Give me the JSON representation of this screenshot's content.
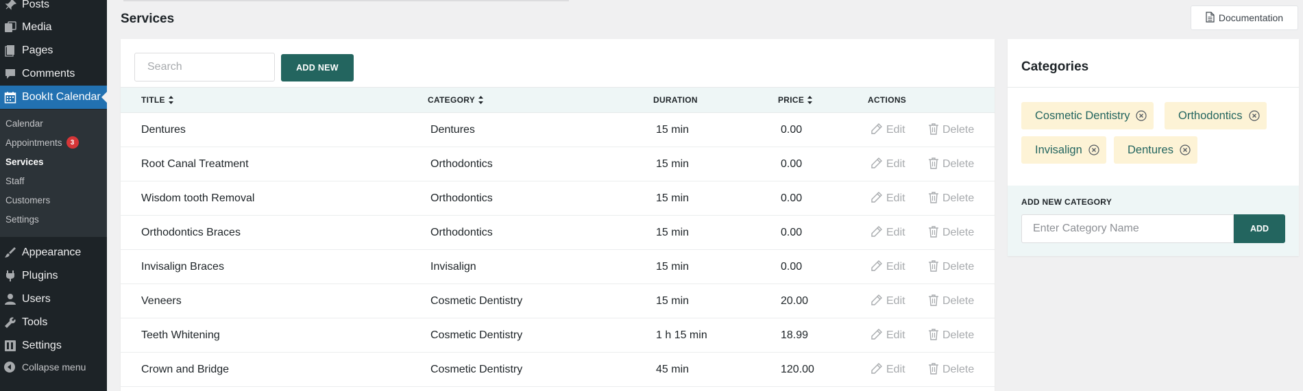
{
  "sidebar": {
    "menu": [
      {
        "label": "Posts",
        "icon": "pin-icon"
      },
      {
        "label": "Media",
        "icon": "media-icon"
      },
      {
        "label": "Pages",
        "icon": "pages-icon"
      },
      {
        "label": "Comments",
        "icon": "comment-icon"
      },
      {
        "label": "BookIt Calendar",
        "icon": "calendar-icon"
      }
    ],
    "submenu": [
      {
        "label": "Calendar"
      },
      {
        "label": "Appointments",
        "badge": "3"
      },
      {
        "label": "Services"
      },
      {
        "label": "Staff"
      },
      {
        "label": "Customers"
      },
      {
        "label": "Settings"
      }
    ],
    "menu2": [
      {
        "label": "Appearance",
        "icon": "brush-icon"
      },
      {
        "label": "Plugins",
        "icon": "plugin-icon"
      },
      {
        "label": "Users",
        "icon": "user-icon"
      },
      {
        "label": "Tools",
        "icon": "wrench-icon"
      },
      {
        "label": "Settings",
        "icon": "settings-icon"
      }
    ],
    "collapse": "Collapse menu"
  },
  "header": {
    "title": "Services",
    "documentation": "Documentation"
  },
  "services": {
    "search_placeholder": "Search",
    "add_new": "ADD NEW",
    "columns": {
      "title": "TITLE",
      "category": "CATEGORY",
      "duration": "DURATION",
      "price": "PRICE",
      "actions": "ACTIONS"
    },
    "edit_label": "Edit",
    "delete_label": "Delete",
    "rows": [
      {
        "title": "Dentures",
        "category": "Dentures",
        "duration": "15 min",
        "price": "0.00"
      },
      {
        "title": "Root Canal Treatment",
        "category": "Orthodontics",
        "duration": "15 min",
        "price": "0.00"
      },
      {
        "title": "Wisdom tooth Removal",
        "category": "Orthodontics",
        "duration": "15 min",
        "price": "0.00"
      },
      {
        "title": "Orthodontics Braces",
        "category": "Orthodontics",
        "duration": "15 min",
        "price": "0.00"
      },
      {
        "title": "Invisalign Braces",
        "category": "Invisalign",
        "duration": "15 min",
        "price": "0.00"
      },
      {
        "title": "Veneers",
        "category": "Cosmetic Dentistry",
        "duration": "15 min",
        "price": "20.00"
      },
      {
        "title": "Teeth Whitening",
        "category": "Cosmetic Dentistry",
        "duration": "1 h 15 min",
        "price": "18.99"
      },
      {
        "title": "Crown and Bridge",
        "category": "Cosmetic Dentistry",
        "duration": "45 min",
        "price": "120.00"
      }
    ]
  },
  "categories": {
    "title": "Categories",
    "items": [
      "Cosmetic Dentistry",
      "Orthodontics",
      "Invisalign",
      "Dentures"
    ],
    "add_label": "ADD NEW CATEGORY",
    "input_placeholder": "Enter Category Name",
    "add_button": "ADD"
  },
  "colors": {
    "accent": "#23655f",
    "admin_bar": "#1d2327",
    "active_menu": "#2271b1",
    "chip_bg": "#fdf3d6"
  }
}
